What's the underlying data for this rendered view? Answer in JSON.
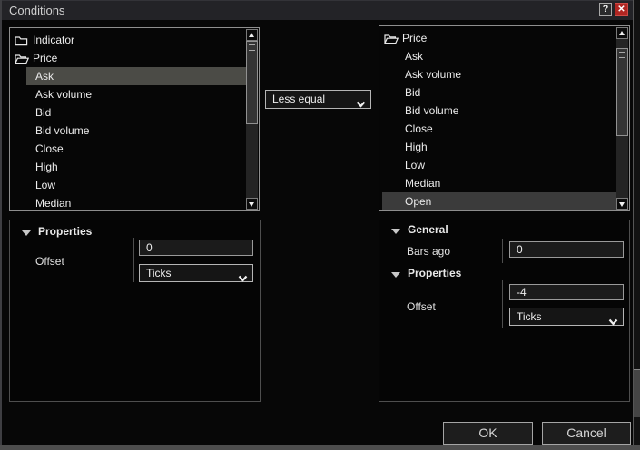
{
  "window": {
    "title": "Conditions",
    "help_label": "?",
    "close_glyph": "✕"
  },
  "left_list": {
    "items": [
      {
        "label": "Indicator",
        "icon": "folder-closed",
        "selected": false
      },
      {
        "label": "Price",
        "icon": "folder-open",
        "selected": false
      },
      {
        "label": "Ask",
        "icon": null,
        "selected": true
      },
      {
        "label": "Ask volume",
        "icon": null,
        "selected": false
      },
      {
        "label": "Bid",
        "icon": null,
        "selected": false
      },
      {
        "label": "Bid volume",
        "icon": null,
        "selected": false
      },
      {
        "label": "Close",
        "icon": null,
        "selected": false
      },
      {
        "label": "High",
        "icon": null,
        "selected": false
      },
      {
        "label": "Low",
        "icon": null,
        "selected": false
      },
      {
        "label": "Median",
        "icon": null,
        "selected": false
      }
    ]
  },
  "right_list": {
    "items": [
      {
        "label": "Price",
        "icon": "folder-open",
        "selected": false
      },
      {
        "label": "Ask",
        "icon": null,
        "selected": false
      },
      {
        "label": "Ask volume",
        "icon": null,
        "selected": false
      },
      {
        "label": "Bid",
        "icon": null,
        "selected": false
      },
      {
        "label": "Bid volume",
        "icon": null,
        "selected": false
      },
      {
        "label": "Close",
        "icon": null,
        "selected": false
      },
      {
        "label": "High",
        "icon": null,
        "selected": false
      },
      {
        "label": "Low",
        "icon": null,
        "selected": false
      },
      {
        "label": "Median",
        "icon": null,
        "selected": false
      },
      {
        "label": "Open",
        "icon": null,
        "selected": true
      }
    ]
  },
  "operator": {
    "value": "Less equal"
  },
  "left_props": {
    "header": "Properties",
    "offset_label": "Offset",
    "offset_value": "0",
    "offset_unit": "Ticks"
  },
  "right_props": {
    "general_header": "General",
    "bars_ago_label": "Bars ago",
    "bars_ago_value": "0",
    "properties_header": "Properties",
    "offset_label": "Offset",
    "offset_value": "-4",
    "offset_unit": "Ticks"
  },
  "buttons": {
    "ok": "OK",
    "cancel": "Cancel"
  },
  "colors": {
    "close_button_red": "#b02622",
    "selection_left": "#4b4b46",
    "selection_right": "#3b3b3b",
    "titlebar_bg": "#232327",
    "panel_border_light": "#8f8f8f",
    "panel_border_dark": "#4e4e4e"
  }
}
